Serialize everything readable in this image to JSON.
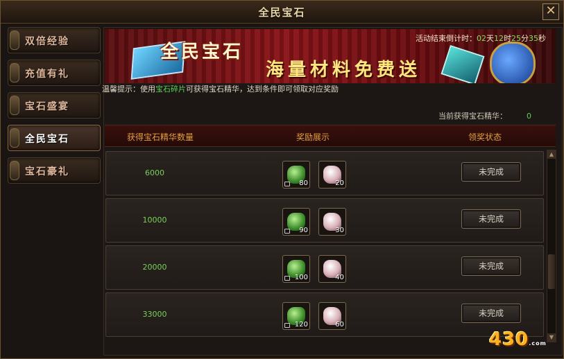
{
  "window": {
    "title": "全民宝石",
    "close_label": "✕"
  },
  "sidebar": {
    "items": [
      {
        "label": "双倍经验",
        "active": false
      },
      {
        "label": "充值有礼",
        "active": false
      },
      {
        "label": "宝石盛宴",
        "active": false
      },
      {
        "label": "全民宝石",
        "active": true
      },
      {
        "label": "宝石豪礼",
        "active": false
      }
    ]
  },
  "banner": {
    "title": "全民宝石",
    "slogan": "海量材料免费送",
    "countdown": {
      "prefix": "活动结束倒计时：",
      "days": "02",
      "days_unit": "天",
      "hours": "12",
      "hours_unit": "时",
      "minutes": "25",
      "minutes_unit": "分",
      "seconds": "35",
      "seconds_unit": "秒"
    }
  },
  "tip": {
    "prefix": "温馨提示：使用",
    "highlight": "宝石碎片",
    "suffix": "可获得宝石精华，达到条件即可领取对应奖励"
  },
  "essence": {
    "label": "当前获得宝石精华：",
    "value": "0"
  },
  "table": {
    "headers": [
      "获得宝石精华数量",
      "奖励展示",
      "领奖状态"
    ],
    "rows": [
      {
        "requirement": "6000",
        "reward1_count": "80",
        "reward2_count": "20",
        "status": "未完成"
      },
      {
        "requirement": "10000",
        "reward1_count": "90",
        "reward2_count": "30",
        "status": "未完成"
      },
      {
        "requirement": "20000",
        "reward1_count": "100",
        "reward2_count": "40",
        "status": "未完成"
      },
      {
        "requirement": "33000",
        "reward1_count": "120",
        "reward2_count": "60",
        "status": "未完成"
      }
    ]
  },
  "watermark": {
    "text": "430",
    "suffix": ".com"
  },
  "colors": {
    "accent_gold": "#e0a040",
    "value_green": "#7ad05a",
    "banner_red": "#8a1418"
  }
}
